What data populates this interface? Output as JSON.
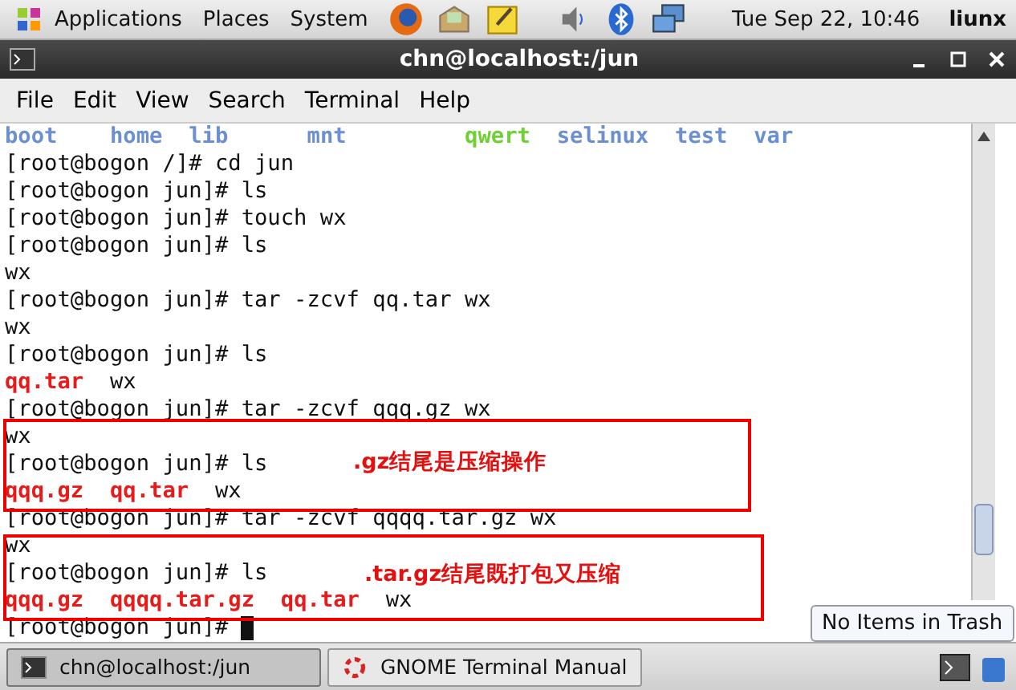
{
  "top_panel": {
    "menus": [
      "Applications",
      "Places",
      "System"
    ],
    "clock": "Tue Sep 22, 10:46",
    "user": "liunx"
  },
  "window": {
    "title": "chn@localhost:/jun"
  },
  "menu_bar": [
    "File",
    "Edit",
    "View",
    "Search",
    "Terminal",
    "Help"
  ],
  "terminal": {
    "lines": [
      [
        {
          "text": "boot    ",
          "kind": "dir"
        },
        {
          "text": "home  ",
          "kind": "dir"
        },
        {
          "text": "lib      ",
          "kind": "dir"
        },
        {
          "text": "mnt         ",
          "kind": "dir"
        },
        {
          "text": "qwert  ",
          "kind": "exec"
        },
        {
          "text": "selinux  ",
          "kind": "dir"
        },
        {
          "text": "test  ",
          "kind": "dir"
        },
        {
          "text": "var",
          "kind": "dir"
        }
      ],
      [
        {
          "text": "[root@bogon /]# cd jun",
          "kind": "plain"
        }
      ],
      [
        {
          "text": "[root@bogon jun]# ls",
          "kind": "plain"
        }
      ],
      [
        {
          "text": "[root@bogon jun]# touch wx",
          "kind": "plain"
        }
      ],
      [
        {
          "text": "[root@bogon jun]# ls",
          "kind": "plain"
        }
      ],
      [
        {
          "text": "wx",
          "kind": "plain"
        }
      ],
      [
        {
          "text": "[root@bogon jun]# tar -zcvf qq.tar wx",
          "kind": "plain"
        }
      ],
      [
        {
          "text": "wx",
          "kind": "plain"
        }
      ],
      [
        {
          "text": "[root@bogon jun]# ls",
          "kind": "plain"
        }
      ],
      [
        {
          "text": "qq.tar  ",
          "kind": "archive"
        },
        {
          "text": "wx",
          "kind": "plain"
        }
      ],
      [
        {
          "text": "[root@bogon jun]# tar -zcvf qqq.gz wx",
          "kind": "plain"
        }
      ],
      [
        {
          "text": "wx",
          "kind": "plain"
        }
      ],
      [
        {
          "text": "[root@bogon jun]# ls",
          "kind": "plain"
        }
      ],
      [
        {
          "text": "qqq.gz  ",
          "kind": "archive"
        },
        {
          "text": "qq.tar  ",
          "kind": "archive"
        },
        {
          "text": "wx",
          "kind": "plain"
        }
      ],
      [
        {
          "text": "[root@bogon jun]# tar -zcvf qqqq.tar.gz wx",
          "kind": "plain"
        }
      ],
      [
        {
          "text": "wx",
          "kind": "plain"
        }
      ],
      [
        {
          "text": "[root@bogon jun]# ls",
          "kind": "plain"
        }
      ],
      [
        {
          "text": "qqq.gz  ",
          "kind": "archive"
        },
        {
          "text": "qqqq.tar.gz  ",
          "kind": "archive"
        },
        {
          "text": "qq.tar  ",
          "kind": "archive"
        },
        {
          "text": "wx",
          "kind": "plain"
        }
      ],
      [
        {
          "text": "[root@bogon jun]# ",
          "kind": "plain"
        }
      ]
    ],
    "annotations": [
      {
        "text": ".gz结尾是压缩操作"
      },
      {
        "text": ".tar.gz结尾既打包又压缩"
      }
    ]
  },
  "tooltip": "No Items in Trash",
  "taskbar": [
    {
      "label": "chn@localhost:/jun",
      "selected": true
    },
    {
      "label": "GNOME Terminal Manual",
      "selected": false
    }
  ]
}
